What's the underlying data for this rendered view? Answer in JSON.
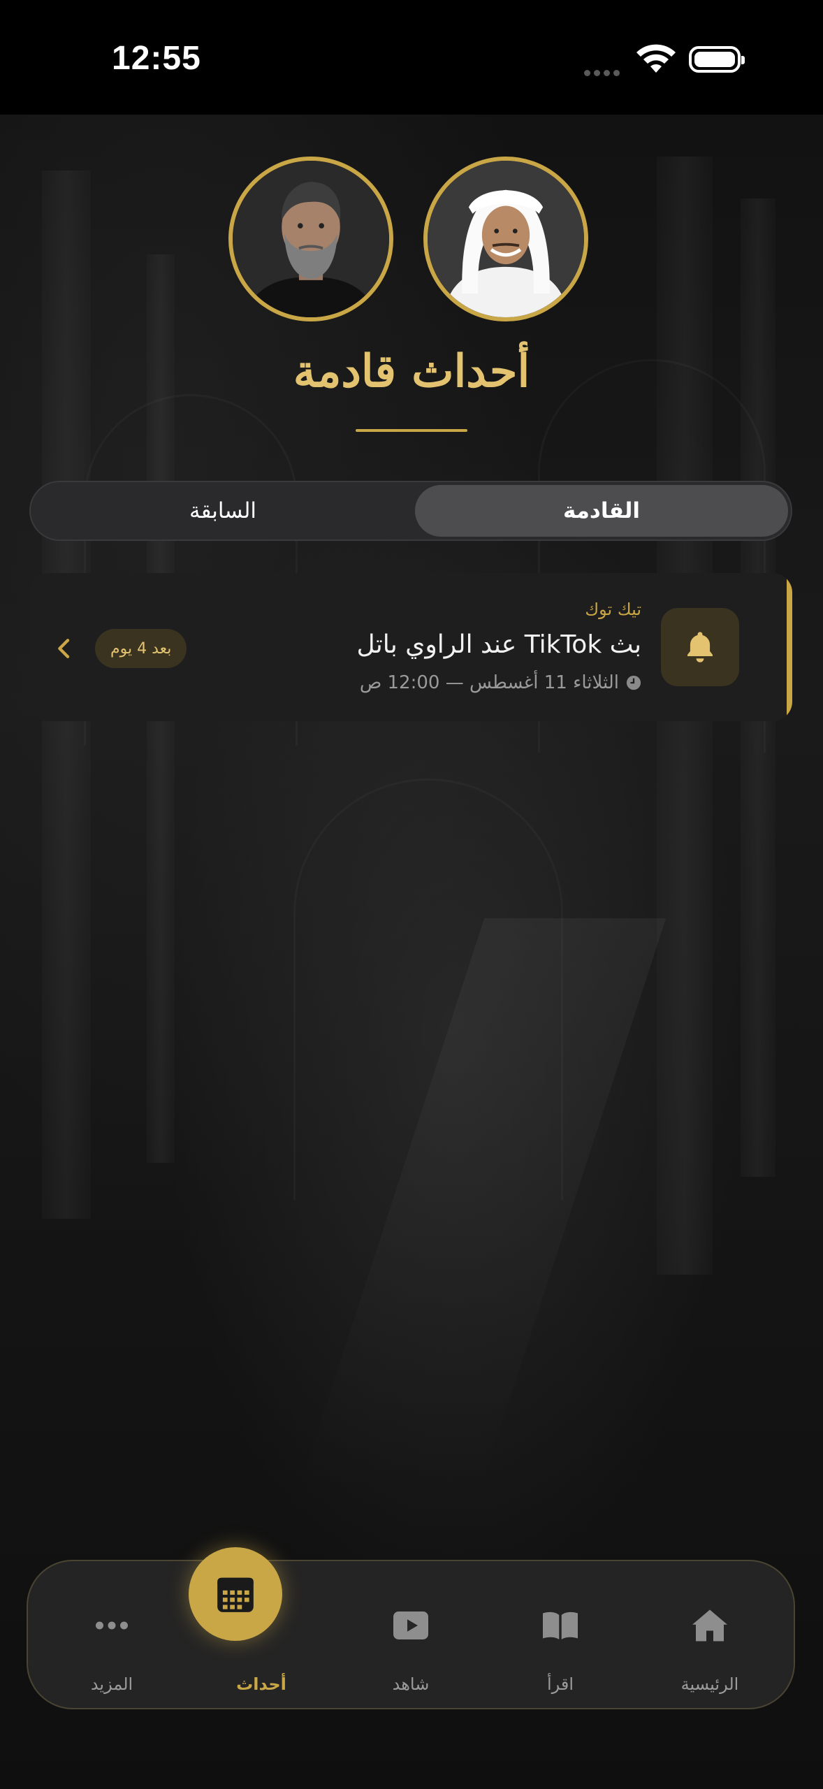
{
  "status_bar": {
    "time": "12:55"
  },
  "header": {
    "title": "أحداث قادمة",
    "narrators": [
      {
        "name": "narrator-bearded"
      },
      {
        "name": "narrator-ghutra"
      }
    ]
  },
  "tabs": [
    {
      "label": "القادمة",
      "selected": true
    },
    {
      "label": "السابقة",
      "selected": false
    }
  ],
  "events": [
    {
      "source": "تيك توك",
      "title": "بث TikTok عند الراوي باتل",
      "datetime": "الثلاثاء 11 أغسطس — 12:00 ص",
      "countdown": "بعد 4 يوم",
      "icon": "bell-icon"
    }
  ],
  "bottom_nav": [
    {
      "label": "الرئيسية",
      "icon": "home-icon",
      "active": false
    },
    {
      "label": "اقرأ",
      "icon": "book-icon",
      "active": false
    },
    {
      "label": "شاهد",
      "icon": "play-icon",
      "active": false
    },
    {
      "label": "أحداث",
      "icon": "calendar-icon",
      "active": true
    },
    {
      "label": "المزيد",
      "icon": "more-icon",
      "active": false
    }
  ],
  "colors": {
    "accent": "#c9a646",
    "background": "#0d0d0d",
    "card": "#1e1e1f"
  }
}
